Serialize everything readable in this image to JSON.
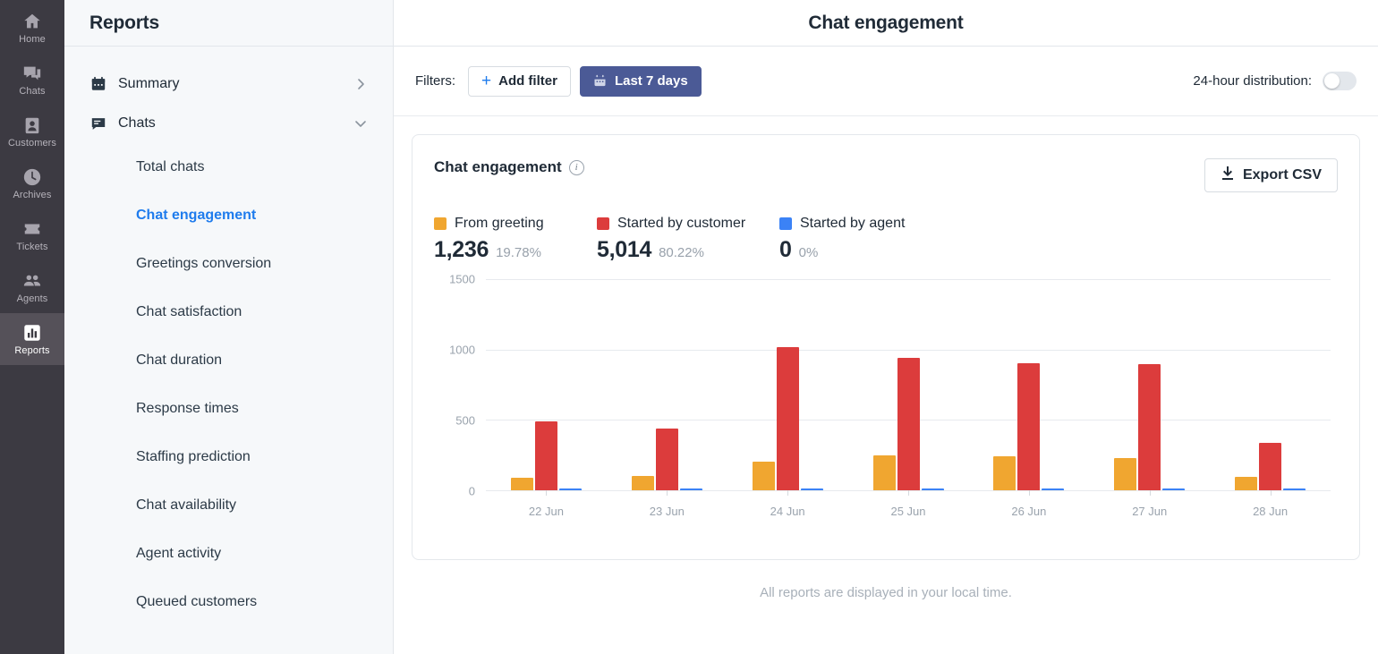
{
  "rail": {
    "items": [
      {
        "label": "Home",
        "icon": "home-icon",
        "active": false
      },
      {
        "label": "Chats",
        "icon": "chats-icon",
        "active": false
      },
      {
        "label": "Customers",
        "icon": "customers-icon",
        "active": false
      },
      {
        "label": "Archives",
        "icon": "archives-clock-icon",
        "active": false
      },
      {
        "label": "Tickets",
        "icon": "tickets-icon",
        "active": false
      },
      {
        "label": "Agents",
        "icon": "agents-icon",
        "active": false
      },
      {
        "label": "Reports",
        "icon": "reports-bar-chart-icon",
        "active": true
      }
    ]
  },
  "sidebar": {
    "title": "Reports",
    "groups": [
      {
        "label": "Summary",
        "icon": "calendar-icon",
        "chevron": "chevron-right"
      },
      {
        "label": "Chats",
        "icon": "chat-bubble-icon",
        "chevron": "chevron-down"
      }
    ],
    "sub_items": [
      {
        "label": "Total chats",
        "active": false
      },
      {
        "label": "Chat engagement",
        "active": true
      },
      {
        "label": "Greetings conversion",
        "active": false
      },
      {
        "label": "Chat satisfaction",
        "active": false
      },
      {
        "label": "Chat duration",
        "active": false
      },
      {
        "label": "Response times",
        "active": false
      },
      {
        "label": "Staffing prediction",
        "active": false
      },
      {
        "label": "Chat availability",
        "active": false
      },
      {
        "label": "Agent activity",
        "active": false
      },
      {
        "label": "Queued customers",
        "active": false
      }
    ]
  },
  "header": {
    "title": "Chat engagement"
  },
  "filters": {
    "label": "Filters:",
    "add_filter_label": "Add filter",
    "add_filter_icon": "plus-icon",
    "date_range_label": "Last 7 days",
    "date_range_icon": "calendar-icon",
    "distribution_label": "24-hour distribution:",
    "distribution_on": false
  },
  "card": {
    "title": "Chat engagement",
    "info_icon": "info-icon",
    "export_label": "Export CSV",
    "export_icon": "download-icon",
    "metrics": [
      {
        "name": "From greeting",
        "value": "1,236",
        "percent": "19.78%",
        "color": "#f0a630"
      },
      {
        "name": "Started by customer",
        "value": "5,014",
        "percent": "80.22%",
        "color": "#dc3c3c"
      },
      {
        "name": "Started by agent",
        "value": "0",
        "percent": "0%",
        "color": "#3b82f6"
      }
    ]
  },
  "footnote": "All reports are displayed in your local time.",
  "chart_data": {
    "type": "bar",
    "title": "Chat engagement",
    "xlabel": "",
    "ylabel": "",
    "ylim": [
      0,
      1500
    ],
    "yticks": [
      0,
      500,
      1000,
      1500
    ],
    "ytick_labels": [
      "0",
      "500",
      "1000",
      "1500"
    ],
    "grid": true,
    "legend_position": "top-left",
    "categories": [
      "22 Jun",
      "23 Jun",
      "24 Jun",
      "25 Jun",
      "26 Jun",
      "27 Jun",
      "28 Jun"
    ],
    "series": [
      {
        "name": "From greeting",
        "color": "#f0a630",
        "values": [
          90,
          102,
          204,
          249,
          243,
          230,
          96
        ]
      },
      {
        "name": "Started by customer",
        "color": "#dc3c3c",
        "values": [
          492,
          440,
          1018,
          940,
          900,
          898,
          340
        ]
      },
      {
        "name": "Started by agent",
        "color": "#3b82f6",
        "values": [
          0,
          0,
          0,
          0,
          0,
          0,
          0
        ]
      }
    ]
  }
}
